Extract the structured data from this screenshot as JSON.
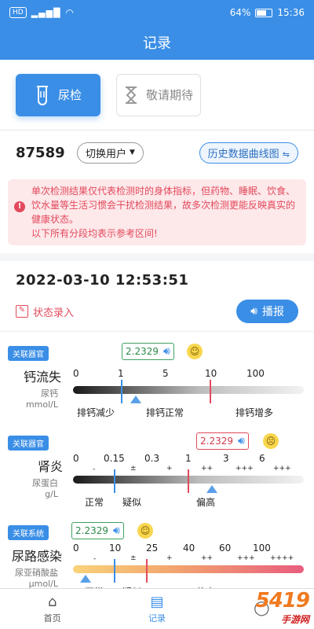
{
  "status_bar": {
    "hd": "HD",
    "battery": "64%",
    "time": "15:36"
  },
  "header": {
    "title": "记录"
  },
  "tabs": [
    {
      "label": "尿检",
      "icon": "test-tube-icon",
      "active": true
    },
    {
      "label": "敬请期待",
      "icon": "hourglass-icon",
      "active": false
    }
  ],
  "user": {
    "id": "87589",
    "switch_label": "切换用户",
    "history_label": "历史数据曲线图"
  },
  "notice": {
    "line1": "单次检测结果仅代表检测时的身体指标，但药物、睡眠、饮食、饮水量等生活习惯会干扰检测结果，故多次检测更能反映真实的健康状态。",
    "line2": "以下所有分段均表示参考区间!"
  },
  "record": {
    "datetime": "2022-03-10 12:53:51",
    "status_entry": "状态录入",
    "play": "播报"
  },
  "items": [
    {
      "tag": "关联器官",
      "name": "钙流失",
      "sub1": "尿钙",
      "sub2": "mmol/L",
      "value": "2.2329",
      "mood": "happy",
      "ticks": [
        "0",
        "1",
        "5",
        "10",
        "100"
      ],
      "symbols": [],
      "zones": [
        "排钙减少",
        "排钙正常",
        "排钙增多"
      ],
      "value_pct": 0.27
    },
    {
      "tag": "关联器官",
      "name": "肾炎",
      "sub1": "尿蛋白",
      "sub2": "g/L",
      "value": "2.2329",
      "mood": "sad",
      "ticks": [
        "0",
        "0.15",
        "0.3",
        "1",
        "3",
        "6"
      ],
      "symbols": [
        "-",
        "±",
        "+",
        "++",
        "+++",
        "+++"
      ],
      "zones": [
        "正常",
        "疑似",
        "偏高"
      ],
      "value_pct": 0.6
    },
    {
      "tag": "关联系统",
      "name": "尿路感染",
      "sub1": "尿亚硝酸盐",
      "sub2": "μmol/L",
      "value": "2.2329",
      "mood": "happy",
      "ticks": [
        "0",
        "10",
        "25",
        "40",
        "60",
        "100"
      ],
      "symbols": [
        "-",
        "±",
        "+",
        "++",
        "+++",
        "++++"
      ],
      "zones": [
        "正常",
        "疑似",
        "偏高"
      ],
      "value_pct": 0.05
    }
  ],
  "bottom_nav": [
    {
      "label": "首页",
      "icon": "home-icon"
    },
    {
      "label": "记录",
      "icon": "record-icon"
    },
    {
      "label": "",
      "icon": "profile-icon"
    }
  ],
  "watermark": {
    "main": "5419",
    "sub": "手游网"
  },
  "colors": {
    "primary": "#3a8ee6",
    "alert": "#e24a5c"
  }
}
